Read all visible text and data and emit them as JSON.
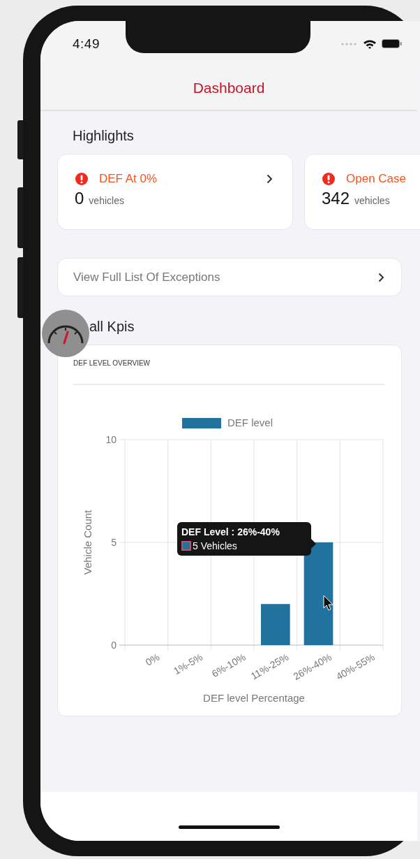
{
  "status_bar": {
    "time": "4:49"
  },
  "header": {
    "title": "Dashboard"
  },
  "highlights": {
    "title": "Highlights",
    "cards": [
      {
        "title": "DEF At 0%",
        "count": "0",
        "unit": "vehicles"
      },
      {
        "title": "Open Case",
        "count": "342",
        "unit": "vehicles"
      }
    ]
  },
  "exceptions_link": {
    "label": "View Full List Of Exceptions"
  },
  "kpis": {
    "title": "all Kpis"
  },
  "chart_card": {
    "title": "DEF LEVEL OVERVIEW",
    "chart_data": {
      "type": "bar",
      "xlabel": "DEF level Percentage",
      "ylabel": "Vehicle Count",
      "categories": [
        "0%",
        "1%-5%",
        "6%-10%",
        "11%-25%",
        "26%-40%",
        "40%-55%"
      ],
      "series": [
        {
          "name": "DEF level",
          "color": "#22729e",
          "values": [
            0,
            0,
            0,
            2,
            5,
            0
          ]
        }
      ],
      "ylim": [
        0,
        10
      ],
      "yticks": [
        0,
        5,
        10
      ]
    },
    "tooltip": {
      "title": "DEF Level : 26%-40%",
      "text": "5 Vehicles"
    }
  }
}
